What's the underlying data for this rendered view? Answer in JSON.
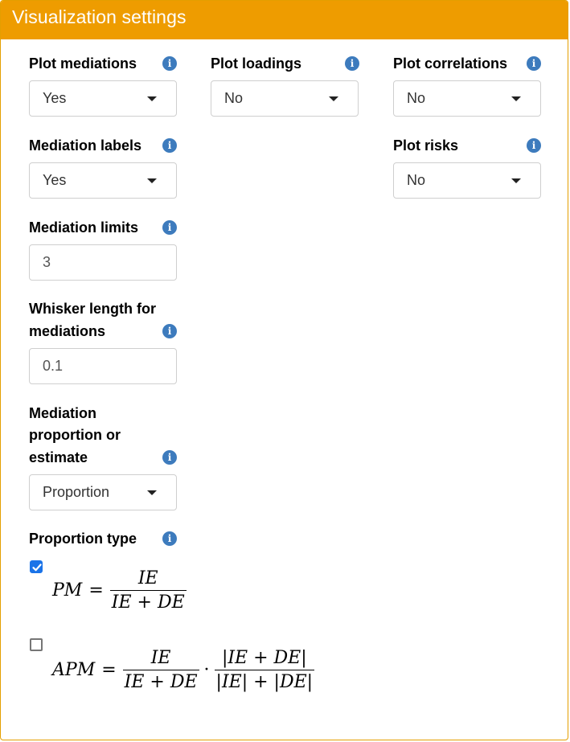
{
  "panel": {
    "title": "Visualization settings"
  },
  "fields": {
    "plot_mediations": {
      "label": "Plot mediations",
      "value": "Yes"
    },
    "plot_loadings": {
      "label": "Plot loadings",
      "value": "No"
    },
    "plot_correlations": {
      "label": "Plot correlations",
      "value": "No"
    },
    "mediation_labels": {
      "label": "Mediation labels",
      "value": "Yes"
    },
    "plot_risks": {
      "label": "Plot risks",
      "value": "No"
    },
    "mediation_limits": {
      "label": "Mediation limits",
      "value": "3"
    },
    "whisker_length": {
      "label_line1": "Whisker length for",
      "label_line2": "mediations",
      "value": "0.1"
    },
    "mediation_prop_est": {
      "label_line1": "Mediation",
      "label_line2": "proportion or",
      "label_line3": "estimate",
      "value": "Proportion"
    },
    "proportion_type": {
      "label": "Proportion type",
      "options": [
        {
          "checked": true,
          "lhs": "PM",
          "eq": "=",
          "num": "IE",
          "den": "IE + DE"
        },
        {
          "checked": false,
          "lhs": "APM",
          "eq": "=",
          "num": "IE",
          "den": "IE + DE",
          "dot": "·",
          "num2": "|IE + DE|",
          "den2": "|IE| + |DE|"
        }
      ]
    }
  },
  "icons": {
    "info": "info-circle",
    "dropdown": "caret-down"
  },
  "colors": {
    "header": "#ee9c00",
    "info_icon": "#3d7bbd",
    "checkbox_checked": "#1a73e8"
  }
}
